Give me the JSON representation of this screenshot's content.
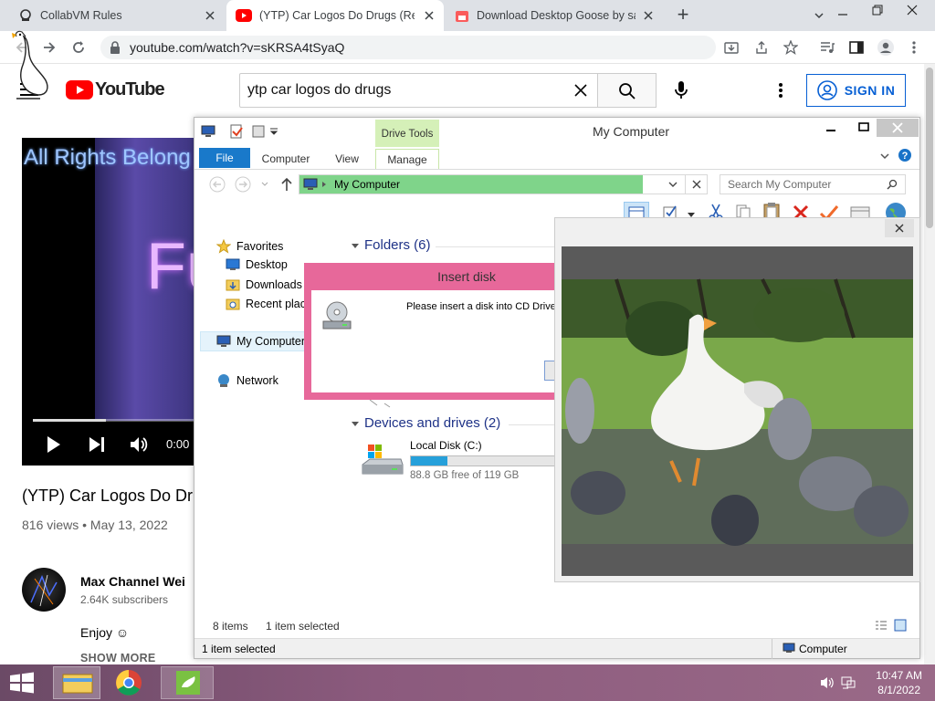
{
  "browser": {
    "tabs": [
      {
        "title": "CollabVM Rules",
        "active": false
      },
      {
        "title": "(YTP) Car Logos Do Drugs (Reupload)",
        "active": true
      },
      {
        "title": "Download Desktop Goose by samperson",
        "active": false
      }
    ],
    "url": "youtube.com/watch?v=sKRSA4tSyaQ",
    "new_tab": "+"
  },
  "youtube": {
    "logo_text": "YouTube",
    "search_query": "ytp car logos do drugs",
    "sign_in": "SIGN IN",
    "video_overlay_text": "All Rights Belong",
    "video_overlay_text2": "Fu",
    "time_display": "0:00",
    "progress_fraction": 0.45,
    "video_title": "(YTP) Car Logos Do Dru",
    "views_date": "816 views • May 13, 2022",
    "channel_name": "Max Channel Wei",
    "subscribers": "2.64K subscribers",
    "description": "Enjoy ☺",
    "show_more": "SHOW MORE"
  },
  "explorer": {
    "title": "My Computer",
    "contextual_group": "Drive Tools",
    "ribbon_tabs": [
      "File",
      "Computer",
      "View",
      "Manage"
    ],
    "address": "My Computer",
    "search_placeholder": "Search My Computer",
    "nav": {
      "favorites": "Favorites",
      "desktop": "Desktop",
      "downloads": "Downloads",
      "recent": "Recent places",
      "mycomputer": "My Computer",
      "network": "Network"
    },
    "folders_header": "Folders (6)",
    "devices_header": "Devices and drives (2)",
    "drive_name": "Local Disk (C:)",
    "drive_free": "88.8 GB free of 119 GB",
    "drive_used_fraction": 0.25,
    "status_items": "8 items",
    "status_selected": "1 item selected",
    "bottom_selected": "1 item selected",
    "bottom_location": "Computer"
  },
  "dialog": {
    "title": "Insert disk",
    "message": "Please insert a disk into CD Drive (D:)."
  },
  "taskbar": {
    "time": "10:47 AM",
    "date": "8/1/2022"
  },
  "colors": {
    "youtube_red": "#ff0000",
    "link_blue": "#065fd4",
    "dialog_frame": "#e7689a",
    "address_highlight": "#7fd48a",
    "ribbon_file": "#1979ca",
    "drive_tools_tab": "#d5f0b8"
  }
}
